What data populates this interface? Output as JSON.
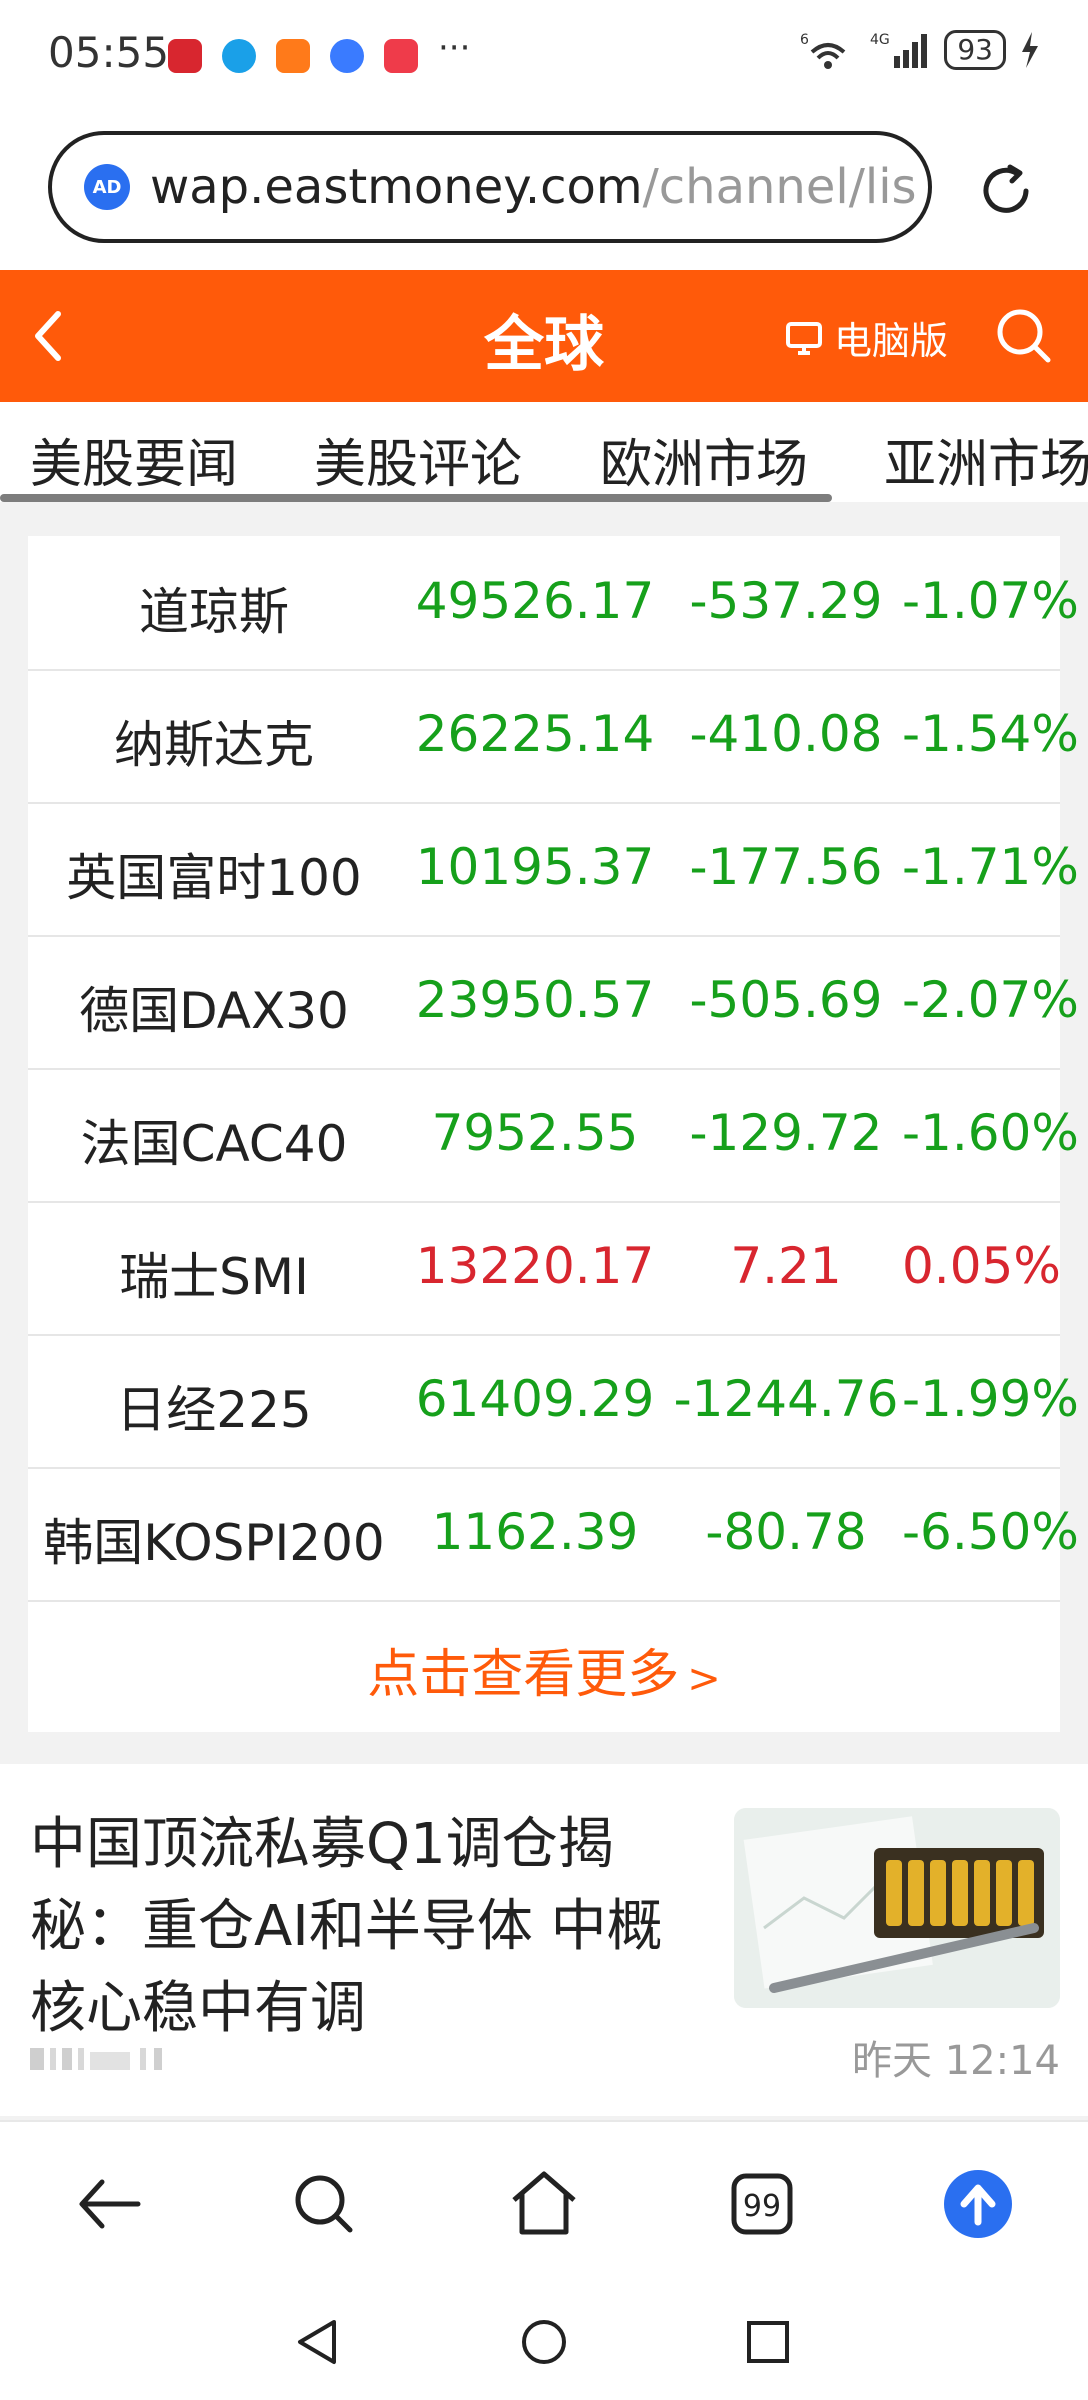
{
  "status_bar": {
    "time": "05:55",
    "signal_labels": [
      "6",
      "4G"
    ],
    "battery": "93",
    "more": "···"
  },
  "url_bar": {
    "badge": "AD",
    "url_domain": "wap.eastmoney.com",
    "url_path": "/channel/lis"
  },
  "header": {
    "title": "全球",
    "pc_version_label": "电脑版"
  },
  "tabs": [
    "美股要闻",
    "美股评论",
    "欧洲市场",
    "亚洲市场"
  ],
  "market_rows": [
    {
      "name": "道琼斯",
      "price": "49526.17",
      "change": "-537.29",
      "percent": "-1.07%",
      "dir": "down"
    },
    {
      "name": "纳斯达克",
      "price": "26225.14",
      "change": "-410.08",
      "percent": "-1.54%",
      "dir": "down"
    },
    {
      "name": "英国富时100",
      "price": "10195.37",
      "change": "-177.56",
      "percent": "-1.71%",
      "dir": "down"
    },
    {
      "name": "德国DAX30",
      "price": "23950.57",
      "change": "-505.69",
      "percent": "-2.07%",
      "dir": "down"
    },
    {
      "name": "法国CAC40",
      "price": "7952.55",
      "change": "-129.72",
      "percent": "-1.60%",
      "dir": "down"
    },
    {
      "name": "瑞士SMI",
      "price": "13220.17",
      "change": "7.21",
      "percent": "0.05%",
      "dir": "up"
    },
    {
      "name": "日经225",
      "price": "61409.29",
      "change": "-1244.76",
      "percent": "-1.99%",
      "dir": "down"
    },
    {
      "name": "韩国KOSPI200",
      "price": "1162.39",
      "change": "-80.78",
      "percent": "-6.50%",
      "dir": "down"
    }
  ],
  "more_link": "点击查看更多",
  "news": {
    "title": "中国顶流私募Q1调仓揭秘：重仓AI和半导体 中概核心稳中有调",
    "time": "昨天 12:14"
  },
  "browser_nav": {
    "tab_count": "99"
  },
  "colors": {
    "brand": "#ff5a0a",
    "down": "#16a01b",
    "up": "#d8262f",
    "fab": "#2a6ff0"
  },
  "icons": [
    "back-icon",
    "search-icon",
    "home-icon",
    "tabs-icon",
    "upload-icon",
    "reload-icon",
    "monitor-icon",
    "chevron-right-icon",
    "triangle-back-icon",
    "circle-home-icon",
    "square-recents-icon"
  ]
}
